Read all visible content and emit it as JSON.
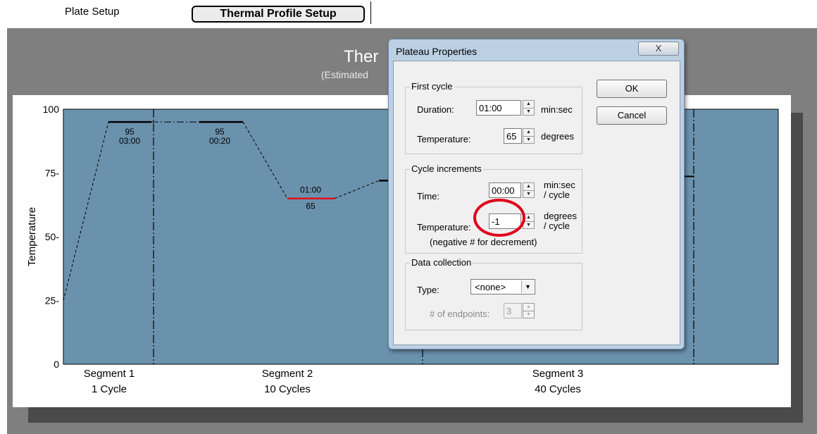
{
  "tabs": {
    "plate_setup": "Plate Setup",
    "thermal_profile_setup": "Thermal Profile Setup"
  },
  "chart_header": {
    "title_visible": "Ther",
    "subtitle_visible": "(Estimated"
  },
  "chart_data": {
    "type": "line",
    "title": "",
    "xlabel": "",
    "ylabel": "Temperature",
    "ylim": [
      0,
      100
    ],
    "yticks": [
      "0",
      "25-",
      "50-",
      "75-",
      "100"
    ],
    "grid": false,
    "plot_bg": "#6b92ad",
    "segments": [
      {
        "name": "Segment 1",
        "cycles": "1 Cycle"
      },
      {
        "name": "Segment 2",
        "cycles": "10 Cycles"
      },
      {
        "name": "Segment 3",
        "cycles": "40 Cycles"
      }
    ],
    "plateaus": [
      {
        "temp": 95,
        "label_top": "95",
        "label_bottom": "03:00",
        "color": "#000000"
      },
      {
        "temp": 95,
        "label_top": "95",
        "label_bottom": "00:20",
        "color": "#000000"
      },
      {
        "temp": 65,
        "label_top": "01:00",
        "label_bottom": "65",
        "color": "#e0101a"
      },
      {
        "temp": 72,
        "label_top": "",
        "label_bottom": "",
        "color": "#000000"
      }
    ],
    "start_temp": 25
  },
  "dialog": {
    "title": "Plateau Properties",
    "close_label": "X",
    "first_cycle": {
      "group_label": "First cycle",
      "duration_label": "Duration:",
      "duration_value": "01:00",
      "duration_unit": "min:sec",
      "temperature_label": "Temperature:",
      "temperature_value": "65",
      "temperature_unit": "degrees"
    },
    "cycle_increments": {
      "group_label": "Cycle increments",
      "time_label": "Time:",
      "time_value": "00:00",
      "time_unit_1": "min:sec",
      "time_unit_2": "/ cycle",
      "temperature_label": "Temperature:",
      "temperature_value": "-1",
      "temperature_unit_1": "degrees",
      "temperature_unit_2": "/ cycle",
      "note": "(negative # for decrement)"
    },
    "data_collection": {
      "group_label": "Data collection",
      "type_label": "Type:",
      "type_value": "<none>",
      "endpoints_label": "# of endpoints:",
      "endpoints_value": "3"
    },
    "ok_label": "OK",
    "cancel_label": "Cancel"
  },
  "spinner": {
    "up": "▲",
    "down": "▼"
  },
  "icons": {
    "dropdown": "▼"
  },
  "colors": {
    "highlight_circle": "#e0001a",
    "dialog_frame": "#bcd0e4"
  }
}
